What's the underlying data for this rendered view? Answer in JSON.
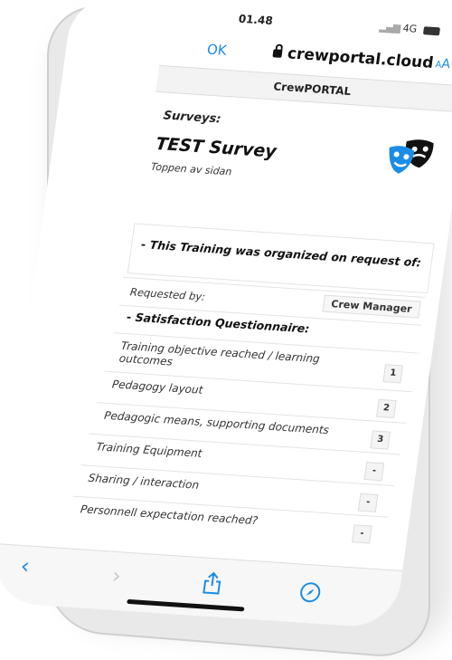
{
  "status": {
    "time": "01.48",
    "network": "4G"
  },
  "browser": {
    "done": "OK",
    "host": "crewportal.cloud",
    "text_size": "AA"
  },
  "app": {
    "header": "CrewPORTAL"
  },
  "page": {
    "section": "Surveys:",
    "title": "TEST Survey",
    "anchor": "Toppen av sidan"
  },
  "training": {
    "org_text": "- This Training was organized on request of:",
    "requested_label": "Requested by:",
    "requested_value": "Crew Manager"
  },
  "questionnaire": {
    "heading": "- Satisfaction Questionnaire:",
    "items": [
      {
        "label": "Training objective reached / learning outcomes",
        "score": "1"
      },
      {
        "label": "Pedagogy layout",
        "score": "2"
      },
      {
        "label": "Pedagogic means, supporting documents",
        "score": "3"
      },
      {
        "label": "Training Equipment",
        "score": "-"
      },
      {
        "label": "Sharing / interaction",
        "score": "-"
      },
      {
        "label": "Personnell expectation reached?",
        "score": "-"
      }
    ]
  },
  "icons": [
    "lock-icon",
    "reload-icon",
    "theater-masks-icon",
    "back-icon",
    "forward-icon",
    "share-icon",
    "compass-icon"
  ]
}
